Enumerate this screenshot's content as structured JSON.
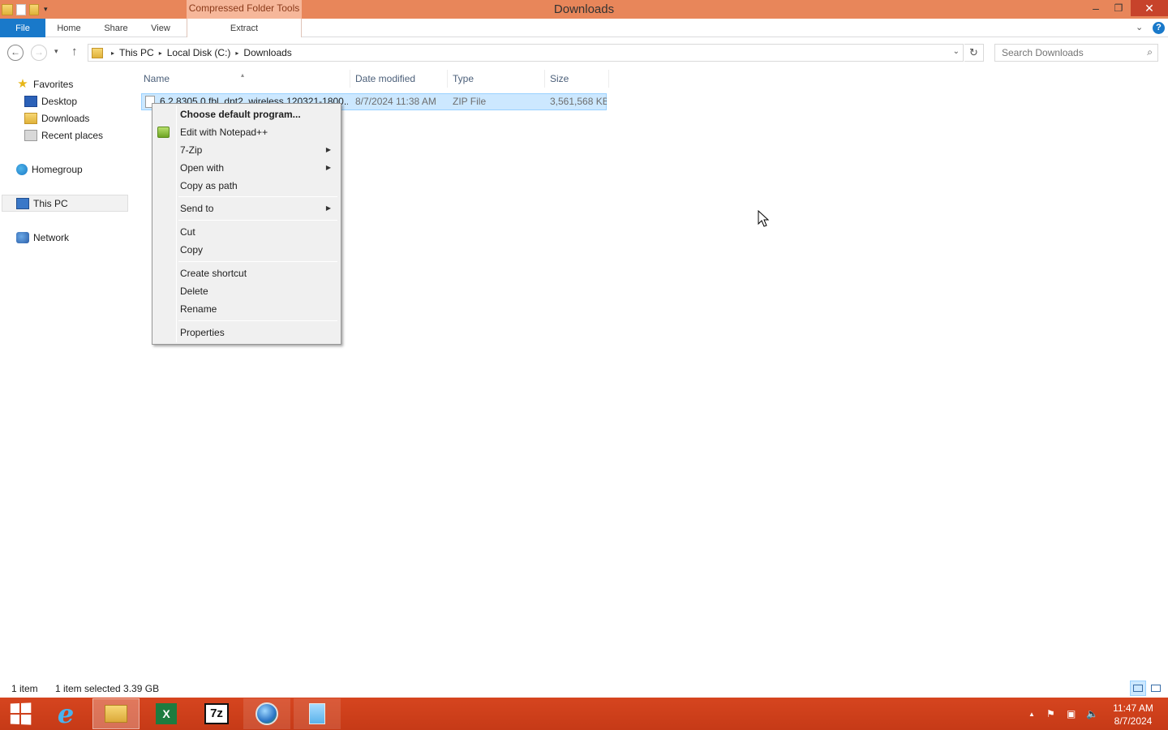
{
  "window": {
    "title": "Downloads",
    "context_tab_group": "Compressed Folder Tools",
    "minimize_glyph": "–",
    "maximize_glyph": "❐",
    "close_glyph": "✕"
  },
  "quick_access": {
    "dropdown_glyph": "▾"
  },
  "ribbon": {
    "tabs": {
      "file": "File",
      "home": "Home",
      "share": "Share",
      "view": "View",
      "extract": "Extract"
    },
    "expand_glyph": "⌄",
    "help_glyph": "?"
  },
  "navigation": {
    "back_glyph": "←",
    "forward_glyph": "→",
    "recent_glyph": "▾",
    "up_glyph": "↑",
    "breadcrumb": [
      "This PC",
      "Local Disk (C:)",
      "Downloads"
    ],
    "breadcrumb_sep": "▸",
    "address_dropdown_glyph": "⌄",
    "refresh_glyph": "↻",
    "search_placeholder": "Search Downloads",
    "search_glyph": "⌕"
  },
  "nav_pane": {
    "favorites": "Favorites",
    "favorites_glyph": "★",
    "desktop": "Desktop",
    "downloads": "Downloads",
    "recent_places": "Recent places",
    "homegroup": "Homegroup",
    "this_pc": "This PC",
    "network": "Network"
  },
  "columns": {
    "name": "Name",
    "date_modified": "Date modified",
    "type": "Type",
    "size": "Size",
    "sort_glyph": "▴"
  },
  "files": [
    {
      "name": "6.2.8305.0.fbl_dnt2_wireless.120321-1800...",
      "date_modified": "8/7/2024 11:38 AM",
      "type": "ZIP File",
      "size": "3,561,568 KB",
      "selected": true
    }
  ],
  "context_menu": {
    "submenu_glyph": "▶",
    "items": {
      "choose_default": "Choose default program...",
      "edit_notepad": "Edit with Notepad++",
      "seven_zip": "7-Zip",
      "open_with": "Open with",
      "copy_as_path": "Copy as path",
      "send_to": "Send to",
      "cut": "Cut",
      "copy": "Copy",
      "create_shortcut": "Create shortcut",
      "delete": "Delete",
      "rename": "Rename",
      "properties": "Properties"
    }
  },
  "status_bar": {
    "item_count": "1 item",
    "selection": "1 item selected  3.39 GB"
  },
  "taskbar": {
    "ie_glyph": "e",
    "excel_glyph": "X",
    "seven_zip_glyph": "7z",
    "tray_up_glyph": "▲",
    "tray_flag_glyph": "⚑",
    "tray_net_glyph": "▣",
    "tray_vol_glyph": "🔈",
    "time": "11:47 AM",
    "date": "8/7/2024"
  },
  "colors": {
    "titlebar": "#e8865a",
    "file_tab": "#1979ca",
    "selection": "#cce8ff",
    "taskbar": "#d6451f",
    "close_button": "#c7432b"
  }
}
